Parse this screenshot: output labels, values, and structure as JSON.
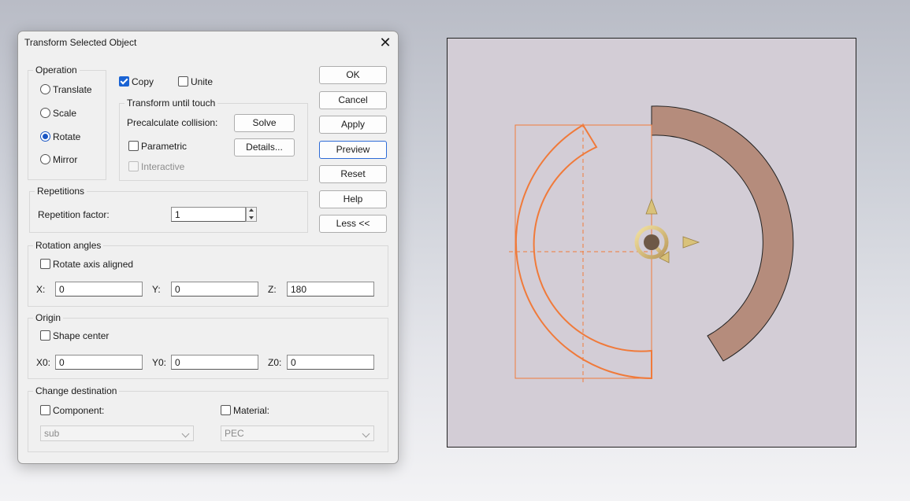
{
  "dialog": {
    "title": "Transform Selected Object",
    "operation": {
      "label": "Operation",
      "options": [
        {
          "label": "Translate",
          "selected": false
        },
        {
          "label": "Scale",
          "selected": false
        },
        {
          "label": "Rotate",
          "selected": true
        },
        {
          "label": "Mirror",
          "selected": false
        }
      ]
    },
    "copy": {
      "label": "Copy",
      "checked": true
    },
    "unite": {
      "label": "Unite",
      "checked": false
    },
    "transform_until_touch": {
      "label": "Transform until touch",
      "precalc_label": "Precalculate collision:",
      "solve_label": "Solve",
      "parametric_label": "Parametric",
      "details_label": "Details...",
      "interactive_label": "Interactive"
    },
    "buttons": {
      "ok": "OK",
      "cancel": "Cancel",
      "apply": "Apply",
      "preview": "Preview",
      "reset": "Reset",
      "help": "Help",
      "less": "Less <<"
    },
    "repetitions": {
      "label": "Repetitions",
      "factor_label": "Repetition factor:",
      "factor_value": "1"
    },
    "rotation_angles": {
      "label": "Rotation angles",
      "axis_aligned_label": "Rotate axis aligned",
      "x_label": "X:",
      "x_value": "0",
      "y_label": "Y:",
      "y_value": "0",
      "z_label": "Z:",
      "z_value": "180"
    },
    "origin": {
      "label": "Origin",
      "shape_center_label": "Shape center",
      "x0_label": "X0:",
      "x0_value": "0",
      "y0_label": "Y0:",
      "y0_value": "0",
      "z0_label": "Z0:",
      "z0_value": "0"
    },
    "change_destination": {
      "label": "Change destination",
      "component_label": "Component:",
      "component_value": "sub",
      "material_label": "Material:",
      "material_value": "PEC"
    }
  },
  "viewport": {
    "background": "#d3cdd6",
    "shape_fill": "#b58c7c",
    "preview_color": "#f07a3a",
    "gizmo_color": "#d9c27a"
  }
}
